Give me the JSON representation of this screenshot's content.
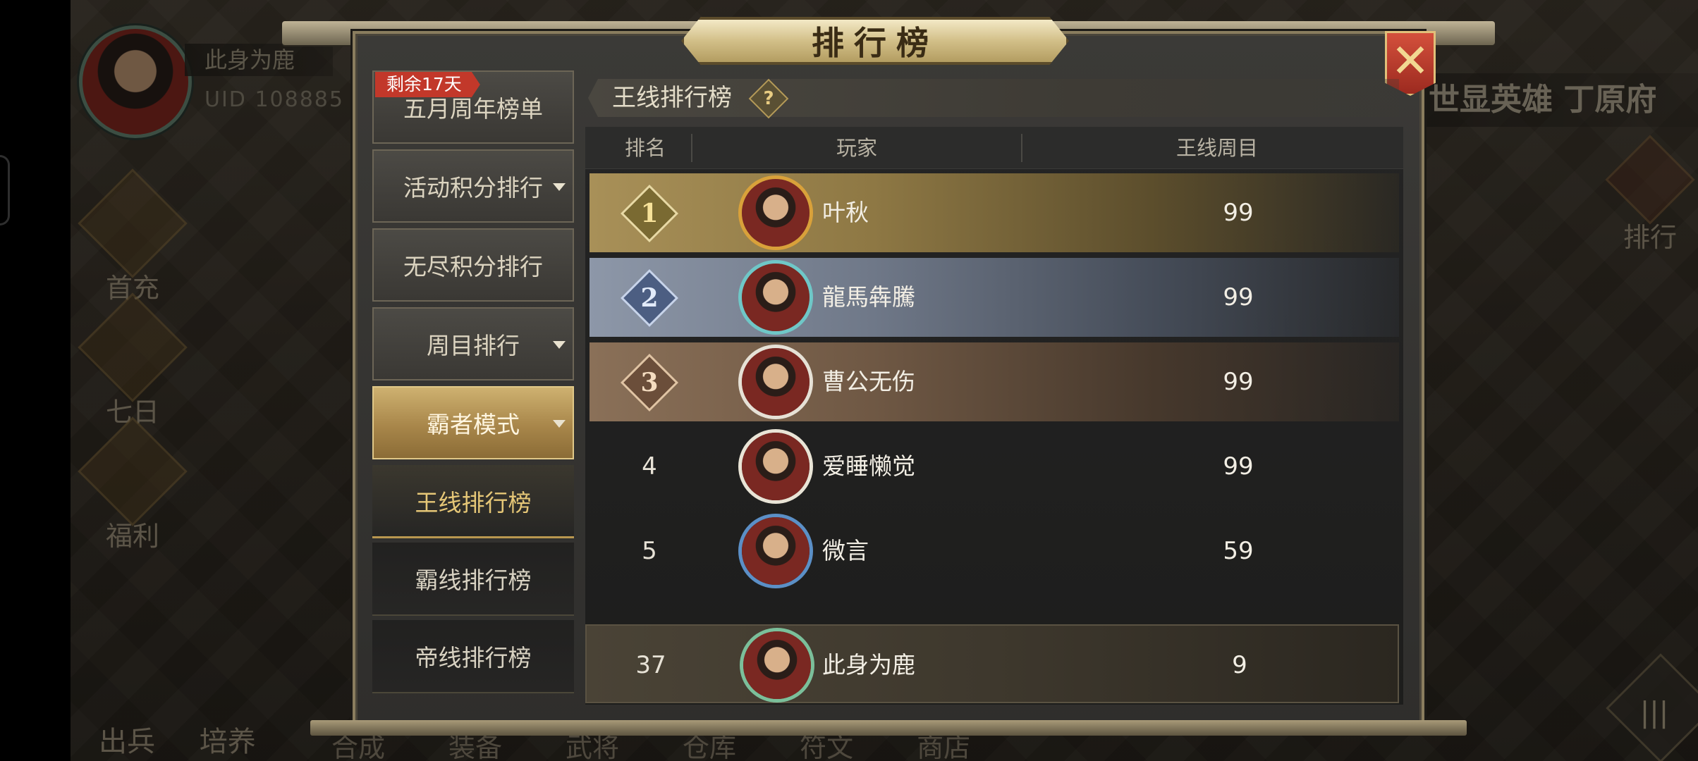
{
  "panel": {
    "title": "排行榜",
    "close_label": "✕"
  },
  "profile": {
    "name": "此身为鹿",
    "uid_label": "UID",
    "uid_value": "108885"
  },
  "left_menu": [
    "首充",
    "七日",
    "福利"
  ],
  "right_area": {
    "title": "世显英雄 丁原府",
    "rank_label": "排行",
    "menu_icon": "menu-grid-icon"
  },
  "bottom_bar": {
    "left_items": [
      "出兵",
      "培养"
    ],
    "items": [
      "合成",
      "装备",
      "武将",
      "仓库",
      "符文",
      "商店"
    ]
  },
  "tabs": {
    "badge": "剩余17天",
    "items": [
      {
        "label": "五月周年榜单",
        "caret": false
      },
      {
        "label": "活动积分排行",
        "caret": true
      },
      {
        "label": "无尽积分排行",
        "caret": false
      },
      {
        "label": "周目排行",
        "caret": true
      },
      {
        "label": "霸者模式",
        "caret": true,
        "active": true
      }
    ],
    "subitems": [
      {
        "label": "王线排行榜",
        "selected": true
      },
      {
        "label": "霸线排行榜",
        "selected": false
      },
      {
        "label": "帝线排行榜",
        "selected": false
      }
    ]
  },
  "section": {
    "title": "王线排行榜",
    "help_label": "?"
  },
  "table": {
    "headers": {
      "rank": "排名",
      "player": "玩家",
      "score": "王线周目"
    },
    "rows": [
      {
        "rank": "1",
        "name": "叶秋",
        "score": "99",
        "style": "gold"
      },
      {
        "rank": "2",
        "name": "龍馬犇騰",
        "score": "99",
        "style": "silver"
      },
      {
        "rank": "3",
        "name": "曹公无伤",
        "score": "99",
        "style": "bronze"
      },
      {
        "rank": "4",
        "name": "爱睡懒觉",
        "score": "99",
        "style": "plain"
      },
      {
        "rank": "5",
        "name": "微言",
        "score": "59",
        "style": "plain"
      }
    ],
    "my_row": {
      "rank": "37",
      "name": "此身为鹿",
      "score": "9"
    }
  },
  "colors": {
    "gold": "#a89058",
    "silver": "#8d97a8",
    "bronze": "#8a7058",
    "badge_red": "#c2382a",
    "active_tab": "#ceb170"
  }
}
